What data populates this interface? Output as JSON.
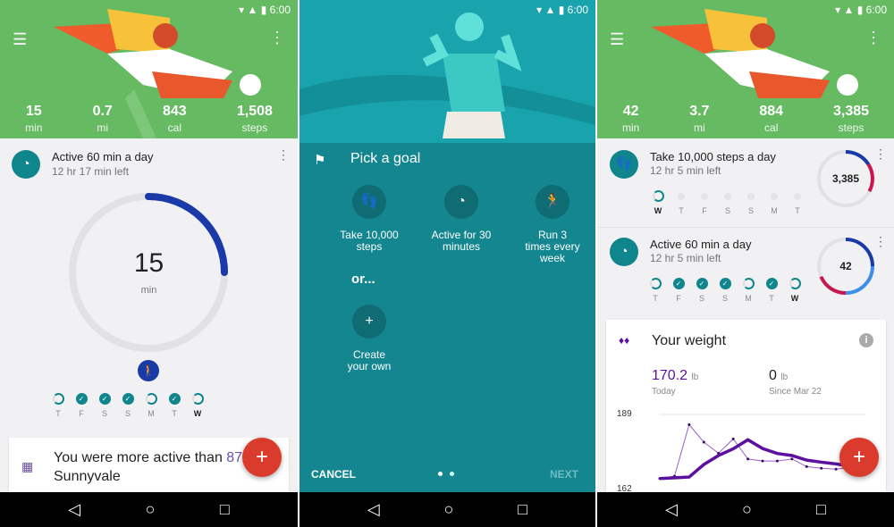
{
  "status": {
    "time": "6:00",
    "icons": [
      "wifi-icon",
      "signal-icon",
      "battery-icon"
    ]
  },
  "nav": {
    "back": "◁",
    "home": "○",
    "recents": "□"
  },
  "screen1": {
    "stats": [
      {
        "value": "15",
        "unit": "min"
      },
      {
        "value": "0.7",
        "unit": "mi"
      },
      {
        "value": "843",
        "unit": "cal"
      },
      {
        "value": "1,508",
        "unit": "steps"
      }
    ],
    "goal": {
      "title": "Active 60 min a day",
      "subtitle": "12 hr 17 min left",
      "value": "15",
      "unit": "min",
      "progress": 0.25
    },
    "days": [
      {
        "l": "T",
        "s": "partial"
      },
      {
        "l": "F",
        "s": "done"
      },
      {
        "l": "S",
        "s": "done"
      },
      {
        "l": "S",
        "s": "done"
      },
      {
        "l": "M",
        "s": "partial"
      },
      {
        "l": "T",
        "s": "done"
      },
      {
        "l": "W",
        "s": "partial",
        "today": true
      }
    ],
    "insight": {
      "text": "You were more active than ",
      "highlight": "87",
      "line2": "Sunnyvale"
    },
    "fab": "+"
  },
  "screen2": {
    "title": "Pick a goal",
    "options": [
      {
        "label": "Take 10,000 steps",
        "icon": "footsteps-icon"
      },
      {
        "label": "Active for 30 minutes",
        "icon": "timer-icon"
      },
      {
        "label": "Run 3 times every week",
        "icon": "runner-icon"
      }
    ],
    "or": "or...",
    "create": "Create your own",
    "cancel": "CANCEL",
    "next": "NEXT"
  },
  "screen3": {
    "stats": [
      {
        "value": "42",
        "unit": "min"
      },
      {
        "value": "3.7",
        "unit": "mi"
      },
      {
        "value": "884",
        "unit": "cal"
      },
      {
        "value": "3,385",
        "unit": "steps"
      }
    ],
    "goal1": {
      "title": "Take 10,000 steps a day",
      "subtitle": "12 hr 5 min left",
      "ring": "3,385",
      "days": [
        {
          "l": "W",
          "s": "partial",
          "today": true
        },
        {
          "l": "T",
          "s": "empty"
        },
        {
          "l": "F",
          "s": "empty"
        },
        {
          "l": "S",
          "s": "empty"
        },
        {
          "l": "S",
          "s": "empty"
        },
        {
          "l": "M",
          "s": "empty"
        },
        {
          "l": "T",
          "s": "empty"
        }
      ]
    },
    "goal2": {
      "title": "Active 60 min a day",
      "subtitle": "12 hr 5 min left",
      "ring": "42",
      "days": [
        {
          "l": "T",
          "s": "partial"
        },
        {
          "l": "F",
          "s": "done"
        },
        {
          "l": "S",
          "s": "done"
        },
        {
          "l": "S",
          "s": "done"
        },
        {
          "l": "M",
          "s": "partial"
        },
        {
          "l": "T",
          "s": "done"
        },
        {
          "l": "W",
          "s": "partial",
          "today": true
        }
      ]
    },
    "weight": {
      "title": "Your weight",
      "today_value": "170.2",
      "today_unit": "lb",
      "today_label": "Today",
      "change_value": "0",
      "change_unit": "lb",
      "change_label": "Since Mar 22",
      "ymax": "189",
      "ymin": "162"
    },
    "fab": "+"
  },
  "chart_data": {
    "type": "line",
    "ylim": [
      162,
      189
    ],
    "yticks": [
      "189",
      "162"
    ],
    "series": [
      {
        "values": [
          167.0,
          167.8,
          185.5,
          179.5,
          175.7,
          180.6,
          173.7,
          173.0,
          173.0,
          173.7,
          171.1,
          170.5,
          170.2,
          170.8,
          169.1
        ],
        "color": "#9c5fc9"
      },
      {
        "values": [
          167.0,
          null,
          167.5,
          171.8,
          174.9,
          177.2,
          180.3,
          177.3,
          175.6,
          174.9,
          173.3,
          172.6,
          172.0,
          171.2,
          170.7
        ],
        "color": "#5c10a0"
      }
    ]
  },
  "colors": {
    "green": "#65ba62",
    "teal": "#0f858c",
    "blue": "#1a3aa8",
    "red": "#c8174e",
    "lightblue": "#3d8ee6",
    "fab": "#db3b2c",
    "purple": "#5c10a0"
  }
}
